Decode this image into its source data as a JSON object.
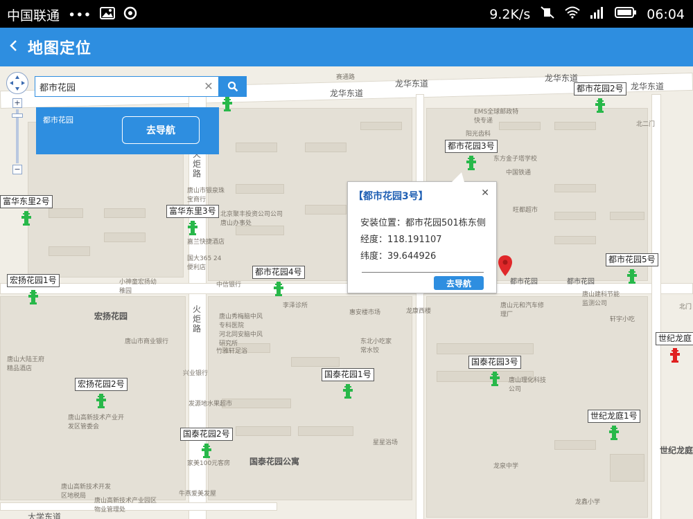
{
  "status_bar": {
    "carrier": "中国联通",
    "dots": "•••",
    "speed": "9.2K/s",
    "time": "06:04"
  },
  "header": {
    "title": "地图定位"
  },
  "search": {
    "value": "都市花园",
    "button_icon": "search-icon"
  },
  "result": {
    "name": "都市花园",
    "nav_label": "去导航"
  },
  "info_popup": {
    "title": "【都市花园3号】",
    "address_label": "安装位置：都市花园501栋东侧",
    "longitude_label": "经度：118.191107",
    "latitude_label": "纬度：39.644926",
    "nav_label": "去导航"
  },
  "markers": [
    {
      "label": "都市花园2号",
      "color": "#28b84a"
    },
    {
      "label": "都市花园3号",
      "color": "#28b84a"
    },
    {
      "label": "富华东里2号",
      "color": "#28b84a"
    },
    {
      "label": "富华东里3号",
      "color": "#28b84a"
    },
    {
      "label": "都市花园4号",
      "color": "#28b84a"
    },
    {
      "label": "都市花园5号",
      "color": "#28b84a"
    },
    {
      "label": "宏扬花园1号",
      "color": "#28b84a"
    },
    {
      "label": "世纪龙庭",
      "color": "#e02020"
    },
    {
      "label": "国泰花园3号",
      "color": "#28b84a"
    },
    {
      "label": "国泰花园1号",
      "color": "#28b84a"
    },
    {
      "label": "宏扬花园2号",
      "color": "#28b84a"
    },
    {
      "label": "世纪龙庭1号",
      "color": "#28b84a"
    },
    {
      "label": "国泰花园2号",
      "color": "#28b84a"
    }
  ],
  "map_labels": {
    "road_longhua_1": "龙华东道",
    "road_longhua_2": "龙华东道",
    "road_longhua_3": "龙华东道",
    "road_longhua_4": "龙华东道",
    "road_huoju": "火炬路",
    "road_huoju_2": "火炬路",
    "hongyang": "宏扬花园",
    "guotai": "国泰花园公寓",
    "shiji": "世纪龙庭",
    "dushi": "都市花园",
    "dushi_2": "都市花园",
    "saitong": "赛通路",
    "ems": "EMS全球邮政特快专递",
    "yangguang": "阳光齿科",
    "dongfang": "东方金子塔学校",
    "tiejian": "中国铁通",
    "wangdu": "旺都超市",
    "zhongxin": "中信银行",
    "lize": "李泽诊所",
    "huian": "惠安楼市场",
    "longkang": "龙康西楼",
    "tangshanjian": "唐山建科节能监测公司",
    "xuanyu": "轩宇小吃",
    "beimen": "北门",
    "beimen2": "北二门",
    "shangye": "唐山市商业银行",
    "xingye": "兴业银行",
    "zhujun": "竹雅轩足浴",
    "xiaoshen": "小神童宏扬幼稚园",
    "fazhan": "发源地水果超市",
    "lvmei": "家美100元客房",
    "niuyi": "牛燕爱美发屋",
    "dongxue": "东北小吃家常水饺",
    "lianxin": "星星浴场",
    "longquan": "龙泉中学",
    "longxin": "龙鑫小学",
    "jiaxue": "嘉兰快捷酒店",
    "shenqian": "国大365 24便利店",
    "juxian": "北京聚丰投资公司公司唐山办事处",
    "bangzhu": "唐山市银泉珠宝商行",
    "yuanhe": "唐山元和汽车修理厂",
    "zhongyi": "唐山秀梅脑中风专科医院",
    "hebei": "河北同安脑中风研究所",
    "dadu": "大学东道",
    "tongxin": "唐山理化科技公司",
    "gaoxin1": "唐山高新技术产业开发区管委会",
    "gaoxin2": "唐山高新技术开发区地税局",
    "gaoxin3": "唐山高新技术产业园区物业管理处",
    "dalu": "唐山大陆王府精品酒店"
  }
}
